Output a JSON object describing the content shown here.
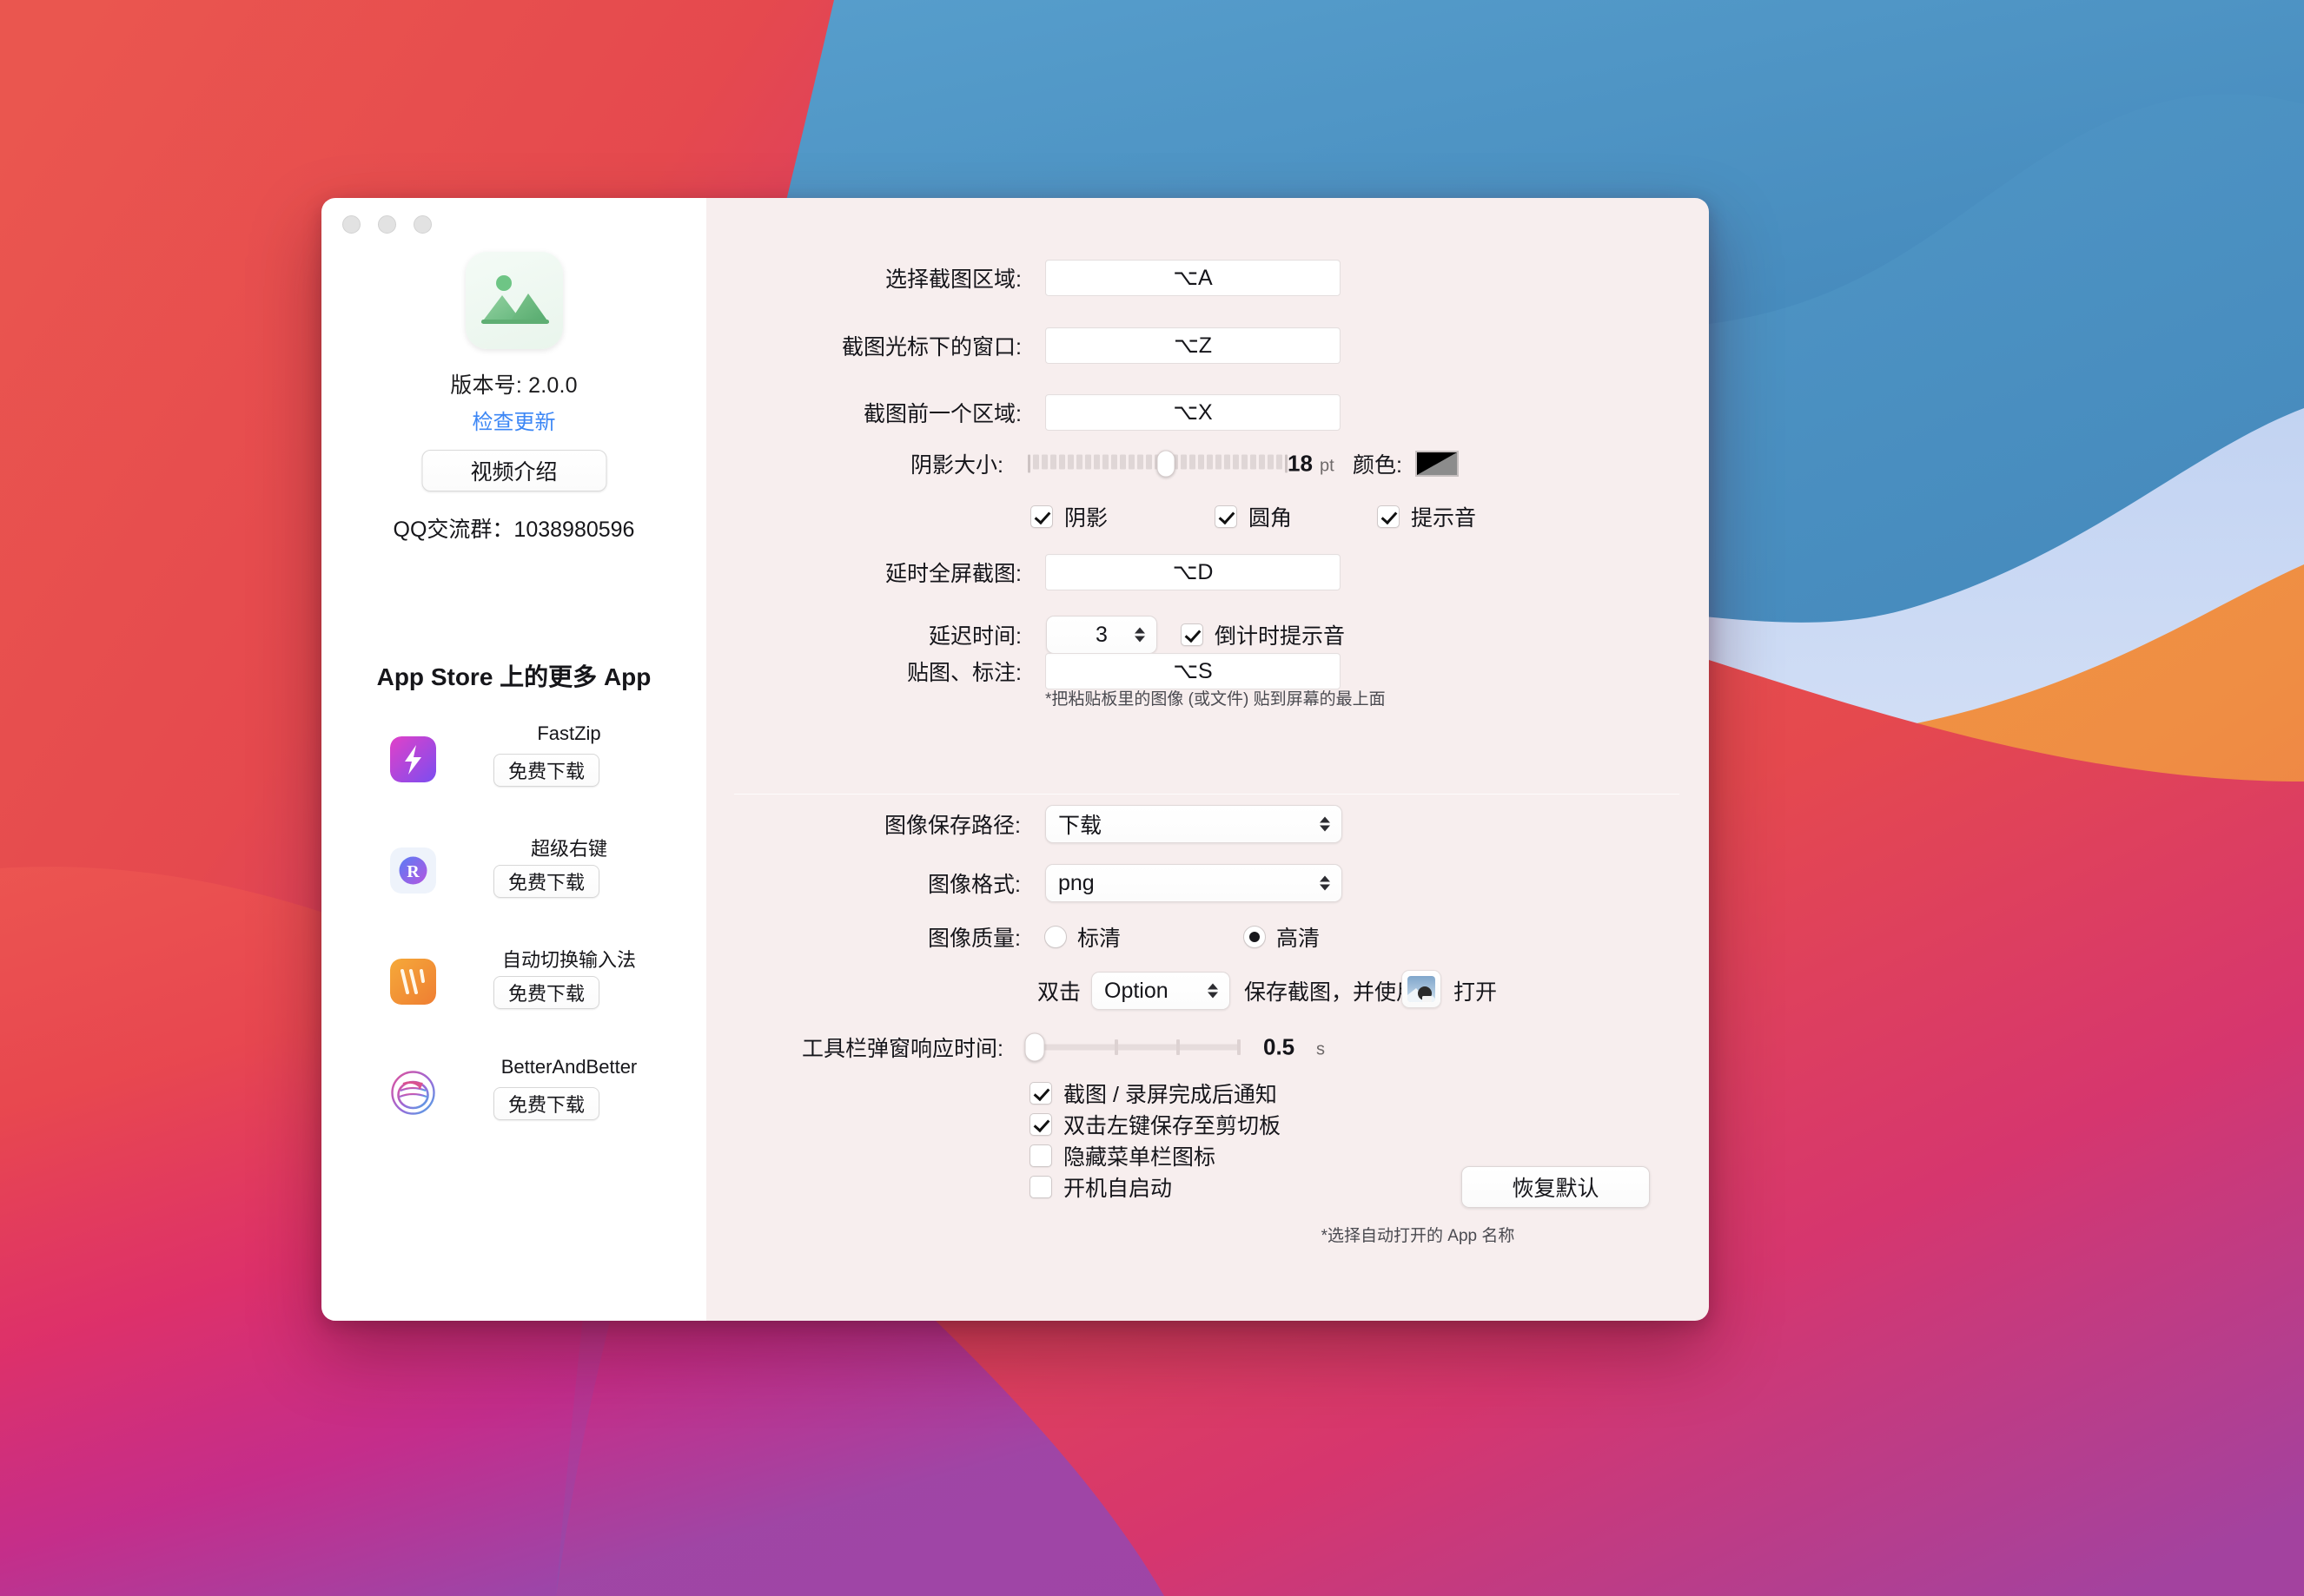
{
  "window": {
    "traffic_lights": [
      "close",
      "minimize",
      "zoom"
    ]
  },
  "sidebar": {
    "app_icon": "photo-mountain-icon",
    "version_label": "版本号: 2.0.0",
    "check_update_label": "检查更新",
    "video_intro_label": "视频介绍",
    "qq_group_label": "QQ交流群：1038980596",
    "store_title": "App Store 上的更多 App",
    "apps": [
      {
        "name": "FastZip",
        "download_label": "免费下载",
        "icon": "fastzip-icon"
      },
      {
        "name": "超级右键",
        "download_label": "免费下载",
        "icon": "super-right-click-icon"
      },
      {
        "name": "自动切换输入法",
        "download_label": "免费下载",
        "icon": "auto-input-switch-icon"
      },
      {
        "name": "BetterAndBetter",
        "download_label": "免费下载",
        "icon": "betterandbetter-icon"
      }
    ]
  },
  "main": {
    "shortcuts": [
      {
        "label": "选择截图区域:",
        "value": "⌥A"
      },
      {
        "label": "截图光标下的窗口:",
        "value": "⌥Z"
      },
      {
        "label": "截图前一个区域:",
        "value": "⌥X"
      }
    ],
    "shadow_size": {
      "label": "阴影大小:",
      "value": "18",
      "unit": "pt",
      "min": 0,
      "max": 40,
      "color_label": "颜色:",
      "color_value": "#000000"
    },
    "toggles_row1": [
      {
        "label": "阴影",
        "checked": true
      },
      {
        "label": "圆角",
        "checked": true
      },
      {
        "label": "提示音",
        "checked": true
      }
    ],
    "delay_fullscreen": {
      "label": "延时全屏截图:",
      "value": "⌥D"
    },
    "delay_time": {
      "label": "延迟时间:",
      "value": "3",
      "countdown_label": "倒计时提示音",
      "countdown_checked": true
    },
    "sticker": {
      "label": "贴图、标注:",
      "value": "⌥S",
      "hint": "*把粘贴板里的图像 (或文件) 贴到屏幕的最上面"
    },
    "save_path": {
      "label": "图像保存路径:",
      "value": "下载"
    },
    "image_format": {
      "label": "图像格式:",
      "value": "png"
    },
    "image_quality": {
      "label": "图像质量:",
      "options": [
        {
          "label": "标清",
          "selected": false
        },
        {
          "label": "高清",
          "selected": true
        }
      ]
    },
    "double_click": {
      "prefix": "双击",
      "modifier": "Option",
      "suffix": "保存截图，并使用",
      "app_icon": "preview-app-icon",
      "open_label": "打开",
      "hint": "*选择自动打开的 App 名称"
    },
    "toolbar_delay": {
      "label": "工具栏弹窗响应时间:",
      "value": "0.5",
      "unit": "s"
    },
    "bottom_toggles": [
      {
        "label": "截图 / 录屏完成后通知",
        "checked": true
      },
      {
        "label": "双击左键保存至剪切板",
        "checked": true
      },
      {
        "label": "隐藏菜单栏图标",
        "checked": false
      },
      {
        "label": "开机自启动",
        "checked": false
      }
    ],
    "restore_default_label": "恢复默认"
  }
}
